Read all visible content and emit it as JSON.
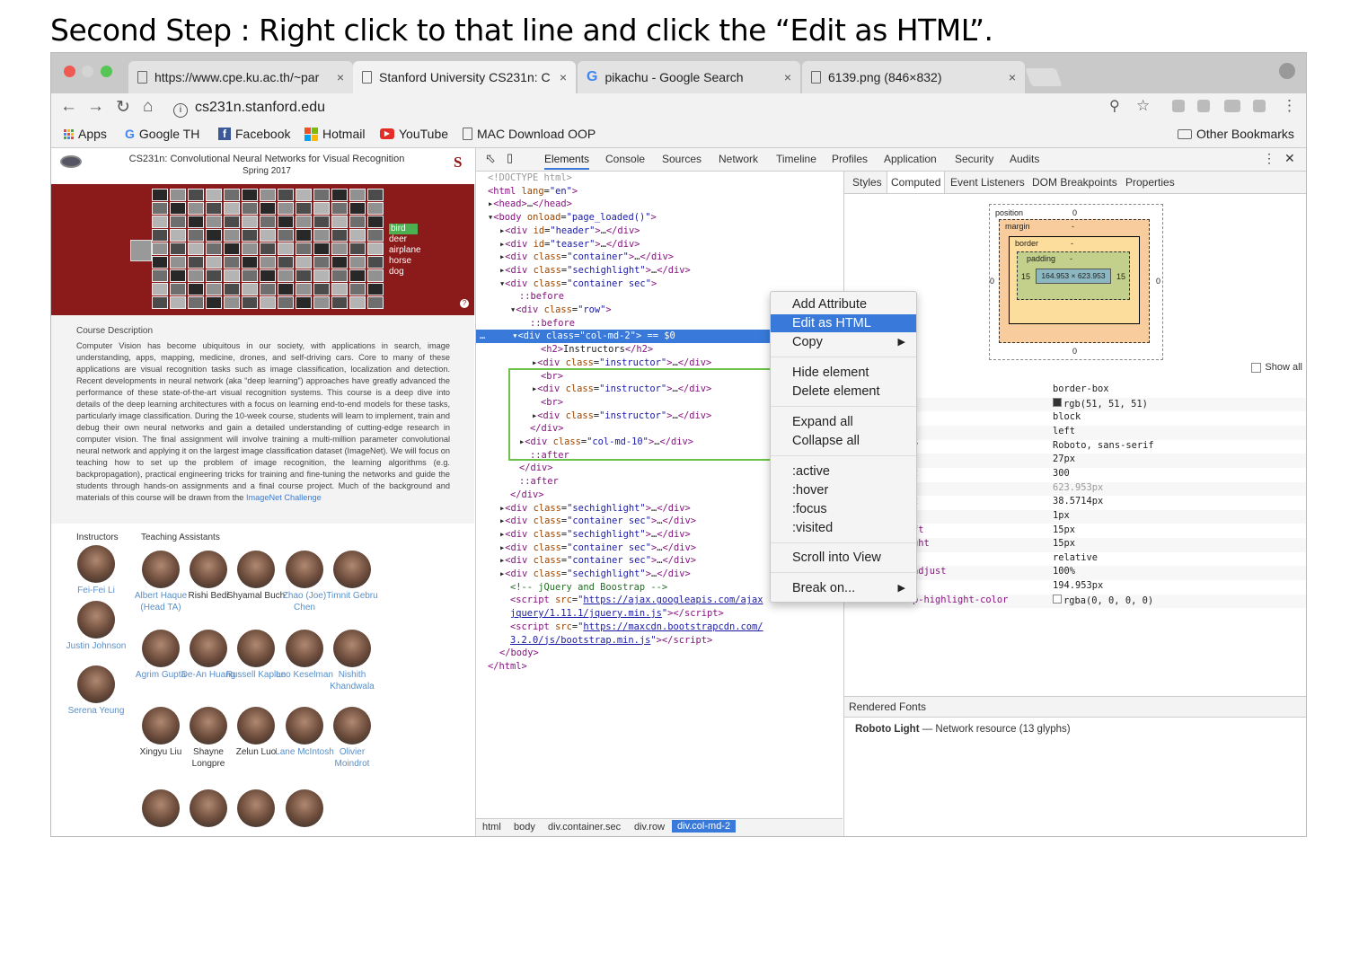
{
  "caption": "Second Step : Right click to that line and click the “Edit as HTML”.",
  "tabs": [
    {
      "title": "https://www.cpe.ku.ac.th/~par",
      "close": "×"
    },
    {
      "title": "Stanford University CS231n: C",
      "close": "×"
    },
    {
      "title": "pikachu - Google Search",
      "close": "×"
    },
    {
      "title": "6139.png (846×832)",
      "close": "×"
    }
  ],
  "address": "cs231n.stanford.edu",
  "bookmarks": [
    "Apps",
    "Google TH",
    "Facebook",
    "Hotmail",
    "YouTube",
    "MAC Download OOP",
    "Other Bookmarks"
  ],
  "site": {
    "title": "CS231n: Convolutional Neural Networks for Visual Recognition",
    "subtitle": "Spring 2017",
    "banner_labels": [
      "bird",
      "deer",
      "airplane",
      "horse",
      "dog"
    ],
    "desc_heading": "Course Description",
    "desc_text": "Computer Vision has become ubiquitous in our society, with applications in search, image understanding, apps, mapping, medicine, drones, and self-driving cars. Core to many of these applications are visual recognition tasks such as image classification, localization and detection. Recent developments in neural network (aka “deep learning”) approaches have greatly advanced the performance of these state-of-the-art visual recognition systems. This course is a deep dive into details of the deep learning architectures with a focus on learning end-to-end models for these tasks, particularly image classification. During the 10-week course, students will learn to implement, train and debug their own neural networks and gain a detailed understanding of cutting-edge research in computer vision. The final assignment will involve training a multi-million parameter convolutional neural network and applying it on the largest image classification dataset (ImageNet). We will focus on teaching how to set up the problem of image recognition, the learning algorithms (e.g. backpropagation), practical engineering tricks for training and fine-tuning the networks and guide the students through hands-on assignments and a final course project. Much of the background and materials of this course will be drawn from the",
    "desc_link": "ImageNet Challenge",
    "instructors_heading": "Instructors",
    "ta_heading": "Teaching Assistants",
    "instructors": [
      "Fei-Fei Li",
      "Justin Johnson",
      "Serena Yeung"
    ],
    "tas": [
      [
        "Albert Haque (Head TA)",
        "Rishi Bedi",
        "Shyamal Buch",
        "Zhao (Joe) Chen",
        "Timnit Gebru"
      ],
      [
        "Agrim Gupta",
        "De-An Huang",
        "Russell Kaplan",
        "Leo Keselman",
        "Nishith Khandwala"
      ],
      [
        "Xingyu Liu",
        "Shayne Longpre",
        "Zelun Luo",
        "Lane McIntosh",
        "Olivier Moindrot"
      ]
    ]
  },
  "devtools": {
    "tabs": [
      "Elements",
      "Console",
      "Sources",
      "Network",
      "Timeline",
      "Profiles",
      "Application",
      "Security",
      "Audits"
    ],
    "side_tabs": [
      "Styles",
      "Computed",
      "Event Listeners",
      "DOM Breakpoints",
      "Properties"
    ],
    "breadcrumbs": [
      "html",
      "body",
      "div.container.sec",
      "div.row",
      "div.col-md-2"
    ],
    "box_model": {
      "position_label": "position",
      "position_val": "0",
      "margin_label": "margin",
      "margin_val": "-",
      "border_label": "border",
      "border_val": "-",
      "padding_label": "padding",
      "padding_val": "-",
      "content": "164.953 × 623.953",
      "pad_left": "15",
      "pad_right": "15",
      "pos_left": "0",
      "pos_right": "0",
      "pos_bottom": "0"
    },
    "show_all": "Show all",
    "computed": [
      {
        "name": "",
        "value": "border-box"
      },
      {
        "name": "",
        "value": "rgb(51, 51, 51)"
      },
      {
        "name": "",
        "value": "block"
      },
      {
        "name": "",
        "value": "left"
      },
      {
        "name": "y",
        "value": "Roboto, sans-serif"
      },
      {
        "name": "",
        "value": "27px"
      },
      {
        "name": "t",
        "value": "300"
      },
      {
        "name": "",
        "value": "623.953px"
      },
      {
        "name": "t",
        "value": "38.5714px"
      },
      {
        "name": "",
        "value": "1px"
      },
      {
        "name": "ft",
        "value": "15px"
      },
      {
        "name": "ght",
        "value": "15px"
      },
      {
        "name": "",
        "value": "relative"
      },
      {
        "name": "adjust",
        "value": "100%"
      },
      {
        "name": "",
        "value": "194.953px"
      },
      {
        "name": "p-highlight-color",
        "value": "rgba(0, 0, 0, 0)"
      }
    ],
    "rendered_fonts_heading": "Rendered Fonts",
    "rendered_font_name": "Roboto Light",
    "rendered_font_detail": "—  Network resource (13 glyphs)"
  },
  "context_menu": {
    "items": [
      "Add Attribute",
      "Edit as HTML",
      "Copy",
      "Hide element",
      "Delete element",
      "Expand all",
      "Collapse all",
      ":active",
      ":hover",
      ":focus",
      ":visited",
      "Scroll into View",
      "Break on..."
    ],
    "highlighted": "Edit as HTML"
  },
  "colors": {
    "accent": "#3879d9",
    "banner": "#8b1a1a",
    "highlight_box": "#6cc24a"
  }
}
